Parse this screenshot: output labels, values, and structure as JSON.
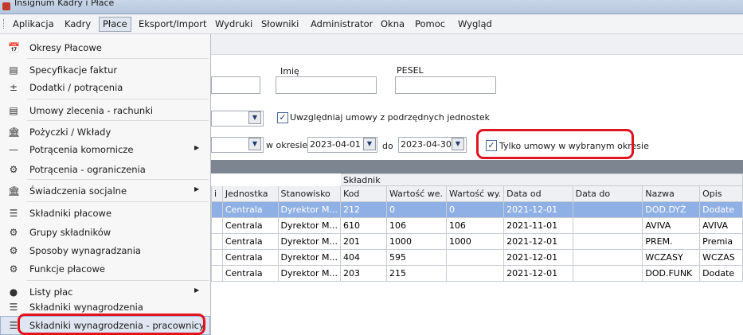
{
  "window": {
    "title": "Insignum Kadry i Płace"
  },
  "menubar": {
    "items": [
      "Aplikacja",
      "Kadry",
      "Płace",
      "Eksport/Import",
      "Wydruki",
      "Słowniki",
      "Administrator",
      "Okna",
      "Pomoc",
      "Wygląd"
    ],
    "active": "Płace"
  },
  "side_menu": {
    "items": [
      {
        "label": "Okresy Płacowe",
        "icon": "calendar-icon"
      },
      {
        "label": "Specyfikacje faktur",
        "icon": "document-icon"
      },
      {
        "label": "Dodatki / potrącenia",
        "icon": "plus-minus-icon"
      },
      {
        "label": "Umowy zlecenia - rachunki",
        "icon": "document-icon"
      },
      {
        "label": "Pożyczki / Wkłady",
        "icon": "bank-icon"
      },
      {
        "label": "Potrącenia komornicze",
        "icon": "minus-icon",
        "submenu": true
      },
      {
        "label": "Potrącenia - ograniczenia",
        "icon": "gears-icon"
      },
      {
        "label": "Świadczenia socjalne",
        "icon": "bank-icon",
        "submenu": true
      },
      {
        "label": "Składniki płacowe",
        "icon": "list-icon"
      },
      {
        "label": "Grupy składników",
        "icon": "gears-icon"
      },
      {
        "label": "Sposoby wynagradzania",
        "icon": "gears-icon"
      },
      {
        "label": "Funkcje płacowe",
        "icon": "gears-icon"
      },
      {
        "label": "Listy płac",
        "icon": "coins-icon",
        "submenu": true
      },
      {
        "label": "Składniki wynagrodzenia",
        "icon": "list-icon"
      },
      {
        "label": "Składniki wynagrodzenia - pracownicy",
        "icon": "list-icon"
      }
    ]
  },
  "filters": {
    "imie_label": "Imię",
    "pesel_label": "PESEL",
    "sub_units_checkbox": "Uwzględniaj umowy z podrzędnych jednostek",
    "period_label": "w okresie",
    "date_from": "2023-04-01",
    "to_label": "do",
    "date_to": "2023-04-30",
    "only_period_checkbox": "Tylko umowy w wybranym okresie"
  },
  "grid": {
    "group_header": "Składnik",
    "columns": [
      "i",
      "Jednostka",
      "Stanowisko",
      "Kod",
      "Wartość we.",
      "Wartość wy.",
      "Data od",
      "Data do",
      "Nazwa",
      "Opis"
    ],
    "rows": [
      [
        "",
        "Centrala",
        "Dyrektor M...",
        "212",
        "0",
        "0",
        "2021-12-01",
        "",
        "DOD.DYŻ",
        "Dodate"
      ],
      [
        "",
        "Centrala",
        "Dyrektor M...",
        "610",
        "106",
        "106",
        "2021-11-01",
        "",
        "AVIVA",
        "AVIVA"
      ],
      [
        "",
        "Centrala",
        "Dyrektor M...",
        "201",
        "1000",
        "1000",
        "2021-12-01",
        "",
        "PREM.",
        "Premia"
      ],
      [
        "",
        "Centrala",
        "Dyrektor M...",
        "404",
        "595",
        "",
        "2021-12-01",
        "",
        "WCZASY",
        "WCZAS"
      ],
      [
        "",
        "Centrala",
        "Dyrektor M...",
        "203",
        "215",
        "",
        "2021-12-01",
        "",
        "DOD.FUNK",
        "Dodate"
      ]
    ]
  }
}
